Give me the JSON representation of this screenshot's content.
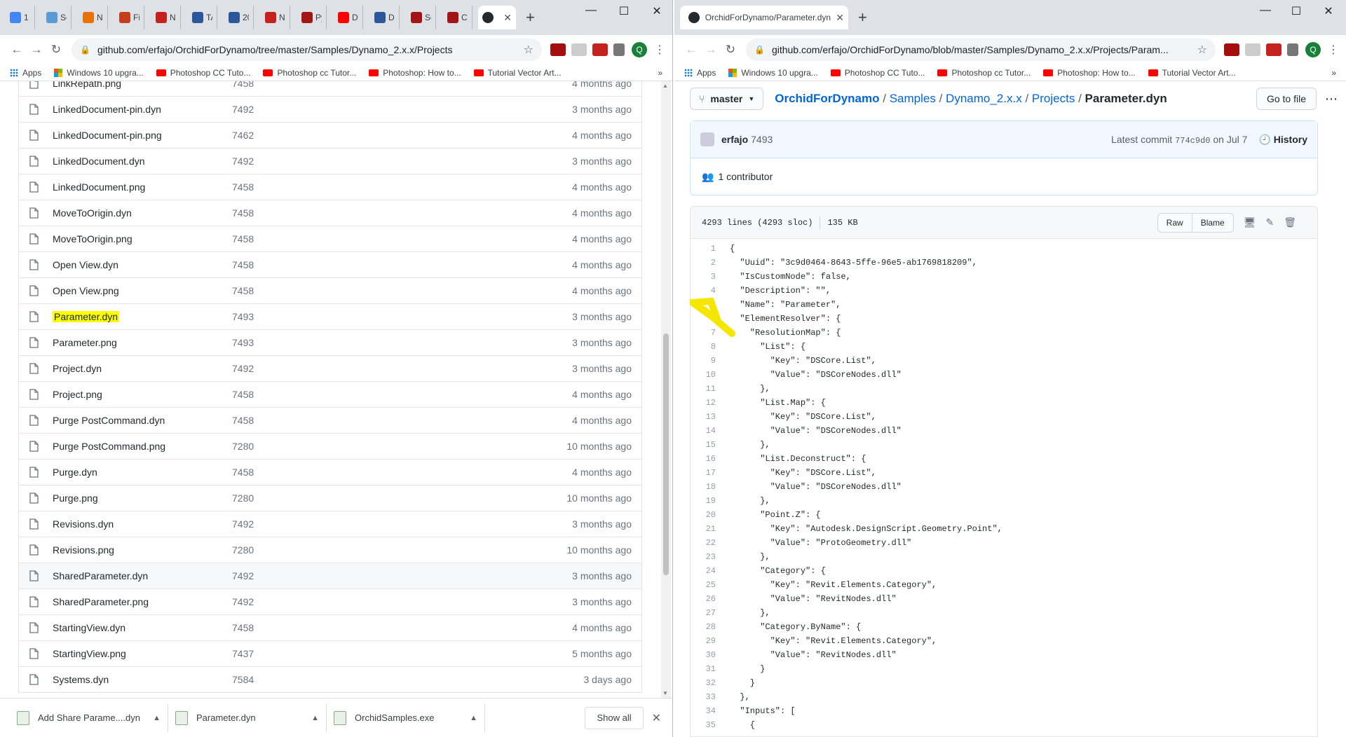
{
  "left_window": {
    "tabs": [
      {
        "label": "1 |",
        "color": "#4285f4"
      },
      {
        "label": "Se",
        "color": "#5b9bd5"
      },
      {
        "label": "N",
        "color": "#e8710a"
      },
      {
        "label": "Fi",
        "color": "#c43e1c"
      },
      {
        "label": "N",
        "color": "#c5221f"
      },
      {
        "label": "TA",
        "color": "#2b579a"
      },
      {
        "label": "20",
        "color": "#2b579a"
      },
      {
        "label": "N",
        "color": "#c5221f"
      },
      {
        "label": "Py",
        "color": "#a31515"
      },
      {
        "label": "D",
        "color": "#ff0000"
      },
      {
        "label": "D",
        "color": "#2b579a"
      },
      {
        "label": "Se",
        "color": "#a31515"
      },
      {
        "label": "Cr",
        "color": "#a31515"
      }
    ],
    "active_tab_close": "✕",
    "url": "github.com/erfajo/OrchidForDynamo/tree/master/Samples/Dynamo_2.x.x/Projects",
    "avatar_letter": "Q",
    "bookmarks": [
      {
        "label": "Apps",
        "icon": "apps-icon"
      },
      {
        "label": "Windows 10 upgra...",
        "icon": "windows-icon"
      },
      {
        "label": "Photoshop CC Tuto...",
        "icon": "youtube-icon"
      },
      {
        "label": "Photoshop cc Tutor...",
        "icon": "youtube-icon"
      },
      {
        "label": "Photoshop: How to...",
        "icon": "youtube-icon"
      },
      {
        "label": "Tutorial Vector Art...",
        "icon": "youtube-icon"
      }
    ],
    "files": [
      {
        "name": "LinkRepath.png",
        "commit": "7458",
        "age": "4 months ago"
      },
      {
        "name": "LinkedDocument-pin.dyn",
        "commit": "7492",
        "age": "3 months ago"
      },
      {
        "name": "LinkedDocument-pin.png",
        "commit": "7462",
        "age": "4 months ago"
      },
      {
        "name": "LinkedDocument.dyn",
        "commit": "7492",
        "age": "3 months ago"
      },
      {
        "name": "LinkedDocument.png",
        "commit": "7458",
        "age": "4 months ago"
      },
      {
        "name": "MoveToOrigin.dyn",
        "commit": "7458",
        "age": "4 months ago"
      },
      {
        "name": "MoveToOrigin.png",
        "commit": "7458",
        "age": "4 months ago"
      },
      {
        "name": "Open View.dyn",
        "commit": "7458",
        "age": "4 months ago"
      },
      {
        "name": "Open View.png",
        "commit": "7458",
        "age": "4 months ago"
      },
      {
        "name": "Parameter.dyn",
        "commit": "7493",
        "age": "3 months ago"
      },
      {
        "name": "Parameter.png",
        "commit": "7493",
        "age": "3 months ago"
      },
      {
        "name": "Project.dyn",
        "commit": "7492",
        "age": "3 months ago"
      },
      {
        "name": "Project.png",
        "commit": "7458",
        "age": "4 months ago"
      },
      {
        "name": "Purge PostCommand.dyn",
        "commit": "7458",
        "age": "4 months ago"
      },
      {
        "name": "Purge PostCommand.png",
        "commit": "7280",
        "age": "10 months ago"
      },
      {
        "name": "Purge.dyn",
        "commit": "7458",
        "age": "4 months ago"
      },
      {
        "name": "Purge.png",
        "commit": "7280",
        "age": "10 months ago"
      },
      {
        "name": "Revisions.dyn",
        "commit": "7492",
        "age": "3 months ago"
      },
      {
        "name": "Revisions.png",
        "commit": "7280",
        "age": "10 months ago"
      },
      {
        "name": "SharedParameter.dyn",
        "commit": "7492",
        "age": "3 months ago"
      },
      {
        "name": "SharedParameter.png",
        "commit": "7492",
        "age": "3 months ago"
      },
      {
        "name": "StartingView.dyn",
        "commit": "7458",
        "age": "4 months ago"
      },
      {
        "name": "StartingView.png",
        "commit": "7437",
        "age": "5 months ago"
      },
      {
        "name": "Systems.dyn",
        "commit": "7584",
        "age": "3 days ago"
      }
    ],
    "highlighted_file_index": 9,
    "hovered_file_index": 19,
    "highlight_color": "#fbff00",
    "downloads": [
      {
        "name": "Add Share Parame....dyn"
      },
      {
        "name": "Parameter.dyn"
      },
      {
        "name": "OrchidSamples.exe"
      }
    ],
    "show_all_label": "Show all"
  },
  "right_window": {
    "tab_title": "OrchidForDynamo/Parameter.dyn",
    "url": "github.com/erfajo/OrchidForDynamo/blob/master/Samples/Dynamo_2.x.x/Projects/Param...",
    "avatar_letter": "Q",
    "bookmarks": [
      {
        "label": "Apps",
        "icon": "apps-icon"
      },
      {
        "label": "Windows 10 upgra...",
        "icon": "windows-icon"
      },
      {
        "label": "Photoshop CC Tuto...",
        "icon": "youtube-icon"
      },
      {
        "label": "Photoshop cc Tutor...",
        "icon": "youtube-icon"
      },
      {
        "label": "Photoshop: How to...",
        "icon": "youtube-icon"
      },
      {
        "label": "Tutorial Vector Art...",
        "icon": "youtube-icon"
      }
    ],
    "branch": "master",
    "breadcrumb": {
      "repo": "OrchidForDynamo",
      "parts": [
        "Samples",
        "Dynamo_2.x.x",
        "Projects"
      ],
      "file": "Parameter.dyn",
      "sep": "/"
    },
    "go_to_file": "Go to file",
    "commit": {
      "author": "erfajo",
      "message": "7493",
      "latest_label": "Latest commit",
      "sha": "774c9d0",
      "date": "on Jul 7",
      "history": "History"
    },
    "contributors": "1 contributor",
    "file_info": {
      "lines": "4293 lines (4293 sloc)",
      "size": "135 KB"
    },
    "buttons": {
      "raw": "Raw",
      "blame": "Blame"
    },
    "code_lines": [
      "{",
      "  \"Uuid\": \"3c9d0464-8643-5ffe-96e5-ab1769818209\",",
      "  \"IsCustomNode\": false,",
      "  \"Description\": \"\",",
      "  \"Name\": \"Parameter\",",
      "  \"ElementResolver\": {",
      "    \"ResolutionMap\": {",
      "      \"List\": {",
      "        \"Key\": \"DSCore.List\",",
      "        \"Value\": \"DSCoreNodes.dll\"",
      "      },",
      "      \"List.Map\": {",
      "        \"Key\": \"DSCore.List\",",
      "        \"Value\": \"DSCoreNodes.dll\"",
      "      },",
      "      \"List.Deconstruct\": {",
      "        \"Key\": \"DSCore.List\",",
      "        \"Value\": \"DSCoreNodes.dll\"",
      "      },",
      "      \"Point.Z\": {",
      "        \"Key\": \"Autodesk.DesignScript.Geometry.Point\",",
      "        \"Value\": \"ProtoGeometry.dll\"",
      "      },",
      "      \"Category\": {",
      "        \"Key\": \"Revit.Elements.Category\",",
      "        \"Value\": \"RevitNodes.dll\"",
      "      },",
      "      \"Category.ByName\": {",
      "        \"Key\": \"Revit.Elements.Category\",",
      "        \"Value\": \"RevitNodes.dll\"",
      "      }",
      "    }",
      "  },",
      "  \"Inputs\": [",
      "    {"
    ],
    "arrow_color": "#f5e600"
  }
}
